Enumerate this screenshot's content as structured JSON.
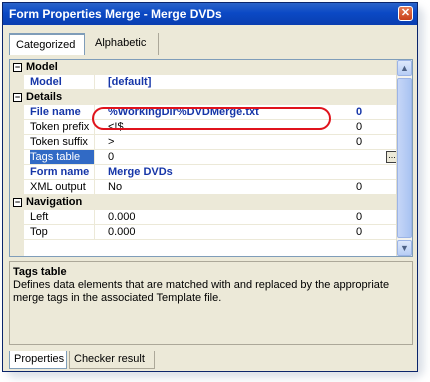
{
  "window": {
    "title": "Form Properties Merge - Merge DVDs",
    "close_glyph": "✕"
  },
  "tabs_top": [
    {
      "label": "Categorized"
    },
    {
      "label": "Alphabetic"
    }
  ],
  "grid": {
    "categories": [
      {
        "label": "Model"
      },
      {
        "label": "Details"
      },
      {
        "label": "Navigation"
      }
    ],
    "rows": [
      {
        "name": "Model",
        "value": "[default]",
        "num": ""
      },
      {
        "name": "File name",
        "value": "%WorkingDir%DVDMerge.txt",
        "num": "0"
      },
      {
        "name": "Token prefix",
        "value": "<!$",
        "num": "0"
      },
      {
        "name": "Token suffix",
        "value": ">",
        "num": "0"
      },
      {
        "name": "Tags table",
        "value": "0",
        "num": ""
      },
      {
        "name": "Form name",
        "value": "Merge DVDs",
        "num": ""
      },
      {
        "name": "XML output",
        "value": "No",
        "num": "0"
      },
      {
        "name": "Left",
        "value": "0.000",
        "num": "0"
      },
      {
        "name": "Top",
        "value": "0.000",
        "num": "0"
      }
    ],
    "expander_glyph": "−",
    "ellipsis": "..."
  },
  "description": {
    "title": "Tags table",
    "text": "Defines data elements that are matched with and replaced by the appropriate merge tags in the associated Template file."
  },
  "tabs_bottom": [
    {
      "label": "Properties"
    },
    {
      "label": "Checker result"
    }
  ],
  "colors": {
    "titlebar": "#0b49c5",
    "highlight": "#e0131c",
    "selection": "#316ac5",
    "bold_value": "#1636a8"
  }
}
